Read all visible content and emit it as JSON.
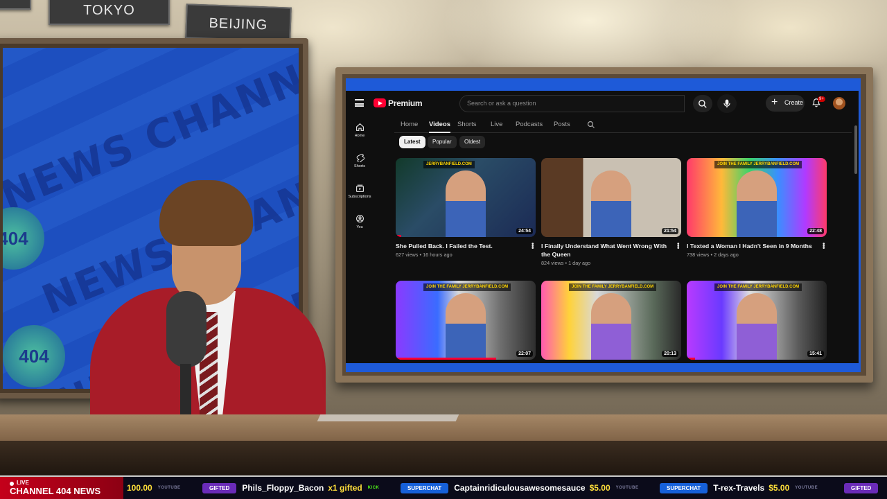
{
  "studio": {
    "signs": [
      "",
      "TOKYO",
      "BEIJING"
    ],
    "watermark_text": "NEWS CHANNEL",
    "watermark_badge": "404"
  },
  "youtube": {
    "brand": "Premium",
    "search_placeholder": "Search or ask a question",
    "create_label": "Create",
    "notification_badge": "9+",
    "sidebar": [
      {
        "label": "Home",
        "icon": "home-icon"
      },
      {
        "label": "Shorts",
        "icon": "shorts-icon"
      },
      {
        "label": "Subscriptions",
        "icon": "subscriptions-icon"
      },
      {
        "label": "You",
        "icon": "you-icon"
      }
    ],
    "tabs": [
      "Home",
      "Videos",
      "Shorts",
      "Live",
      "Podcasts",
      "Posts"
    ],
    "active_tab": "Videos",
    "chips": [
      "Latest",
      "Popular",
      "Oldest"
    ],
    "active_chip": "Latest",
    "videos": [
      {
        "title": "She Pulled Back. I Failed the Test.",
        "views": "627 views",
        "age": "16 hours ago",
        "duration": "24:54",
        "tag": "JERRYBANFIELD.COM",
        "progress": 0.04
      },
      {
        "title": "I Finally Understand What Went Wrong With the Queen",
        "views": "824 views",
        "age": "1 day ago",
        "duration": "21:54",
        "tag": "",
        "progress": 0
      },
      {
        "title": "I Texted a Woman I Hadn't Seen in 9 Months",
        "views": "738 views",
        "age": "2 days ago",
        "duration": "22:48",
        "tag": "JOIN THE FAMILY  JERRYBANFIELD.COM",
        "progress": 0
      },
      {
        "title": "",
        "views": "",
        "age": "",
        "duration": "22:07",
        "tag": "JOIN THE FAMILY  JERRYBANFIELD.COM",
        "progress": 0.72
      },
      {
        "title": "",
        "views": "",
        "age": "",
        "duration": "20:13",
        "tag": "JOIN THE FAMILY  JERRYBANFIELD.COM",
        "progress": 0
      },
      {
        "title": "",
        "views": "",
        "age": "",
        "duration": "15:41",
        "tag": "JOIN THE FAMILY  JERRYBANFIELD.COM",
        "progress": 0.06
      }
    ]
  },
  "ticker": {
    "live_label": "LIVE",
    "channel_label": "CHANNEL 404 NEWS",
    "lead_amount": "100.00",
    "lead_source": "YOUTUBE",
    "items": [
      {
        "badge": "GIFTED",
        "name": "Phils_Floppy_Bacon",
        "extra": "x1 gifted",
        "source": "KICK"
      },
      {
        "badge": "SUPERCHAT",
        "name": "Captainridiculousawesomesauce",
        "extra": "$5.00",
        "source": "YOUTUBE"
      },
      {
        "badge": "SUPERCHAT",
        "name": "T-rex-Travels",
        "extra": "$5.00",
        "source": "YOUTUBE"
      },
      {
        "badge": "GIFTED",
        "name": "",
        "extra": "",
        "source": ""
      }
    ]
  },
  "colors": {
    "yt_red": "#ff0033",
    "gifted": "#6a2bb8",
    "superchat": "#1660d9",
    "live_red": "#c4001a"
  }
}
